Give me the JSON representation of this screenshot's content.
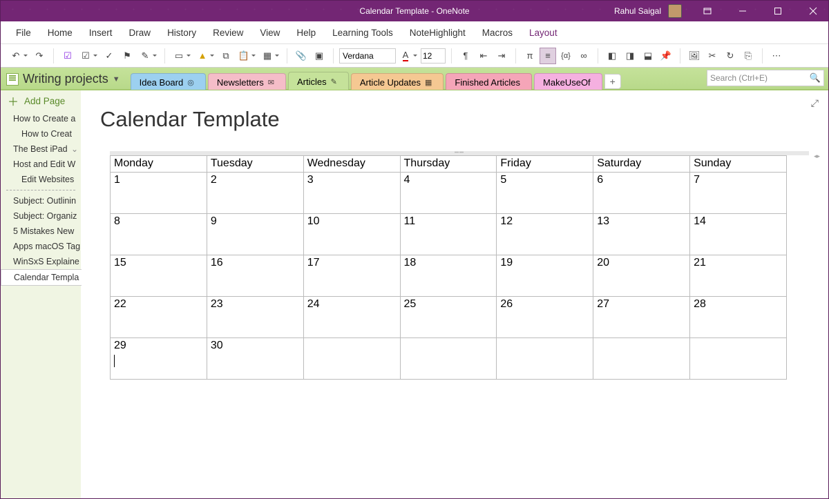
{
  "window": {
    "title": "Calendar Template  -  OneNote",
    "user": "Rahul Saigal"
  },
  "menu": {
    "items": [
      "File",
      "Home",
      "Insert",
      "Draw",
      "History",
      "Review",
      "View",
      "Help",
      "Learning Tools",
      "NoteHighlight",
      "Macros",
      "Layout"
    ],
    "active_index": 11
  },
  "ribbon": {
    "font": "Verdana",
    "size": "12"
  },
  "notebook": {
    "name": "Writing projects"
  },
  "sections": [
    {
      "label": "Idea Board",
      "cls": "t-blue",
      "icon": "◎"
    },
    {
      "label": "Newsletters",
      "cls": "t-pink",
      "icon": "✉"
    },
    {
      "label": "Articles",
      "cls": "t-green",
      "icon": "✎"
    },
    {
      "label": "Article Updates",
      "cls": "t-orange",
      "icon": "▦"
    },
    {
      "label": "Finished Articles",
      "cls": "t-rose",
      "icon": ""
    },
    {
      "label": "MakeUseOf",
      "cls": "t-pink2",
      "icon": ""
    }
  ],
  "search": {
    "placeholder": "Search (Ctrl+E)"
  },
  "sidebar": {
    "add_page": "Add Page",
    "groupA": [
      {
        "label": "How to Create a"
      },
      {
        "label": "How to Creat",
        "indent": true
      },
      {
        "label": "The Best iPad",
        "chev": true
      },
      {
        "label": "Host and Edit W"
      },
      {
        "label": "Edit Websites",
        "indent": true
      }
    ],
    "groupB": [
      {
        "label": "Subject: Outlinin"
      },
      {
        "label": "Subject: Organiz"
      },
      {
        "label": "5 Mistakes New"
      },
      {
        "label": "Apps macOS Tag"
      },
      {
        "label": "WinSxS Explaine"
      },
      {
        "label": "Calendar Templa",
        "selected": true
      }
    ]
  },
  "page": {
    "title": "Calendar Template"
  },
  "chart_data": {
    "type": "table",
    "columns": [
      "Monday",
      "Tuesday",
      "Wednesday",
      "Thursday",
      "Friday",
      "Saturday",
      "Sunday"
    ],
    "rows": [
      [
        "1",
        "2",
        "3",
        "4",
        "5",
        "6",
        "7"
      ],
      [
        "8",
        "9",
        "10",
        "11",
        "12",
        "13",
        "14"
      ],
      [
        "15",
        "16",
        "17",
        "18",
        "19",
        "20",
        "21"
      ],
      [
        "22",
        "23",
        "24",
        "25",
        "26",
        "27",
        "28"
      ],
      [
        "29",
        "30",
        "",
        "",
        "",
        "",
        ""
      ]
    ]
  }
}
